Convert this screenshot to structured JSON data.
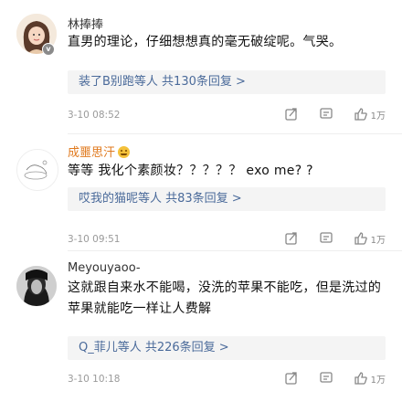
{
  "comments": [
    {
      "username": "林捧捧",
      "text": "直男的理论，仔细想想真的毫无破绽呢。气哭。",
      "replies": "装了B别跑等人 共130条回复 >",
      "time": "3-10 08:52",
      "likes": "1万",
      "user_color": "#333333",
      "has_verified_badge": true,
      "verified_mark": "v"
    },
    {
      "username": "成噩思汗",
      "text": "等等 我化个素颜妆？？？？？ exo me? ?",
      "replies": "哎我的猫呢等人 共83条回复 >",
      "time": "3-10 09:51",
      "likes": "1万",
      "user_color": "#e07a1f",
      "has_verified_badge": false
    },
    {
      "username": "Meyouyaoo-",
      "text": "这就跟自来水不能喝，没洗的苹果不能吃，但是洗过的苹果就能吃一样让人费解",
      "replies": "Q_菲儿等人 共226条回复 >",
      "time": "3-10 10:18",
      "likes": "1万",
      "user_color": "#333333",
      "has_verified_badge": false
    }
  ],
  "icons": {
    "share": "share-icon",
    "comment": "comment-icon",
    "like": "thumb-up-icon"
  },
  "colors": {
    "reply_link": "#4a6a9a",
    "meta_gray": "#9a9a9a",
    "reply_bg": "#f4f4f4"
  }
}
